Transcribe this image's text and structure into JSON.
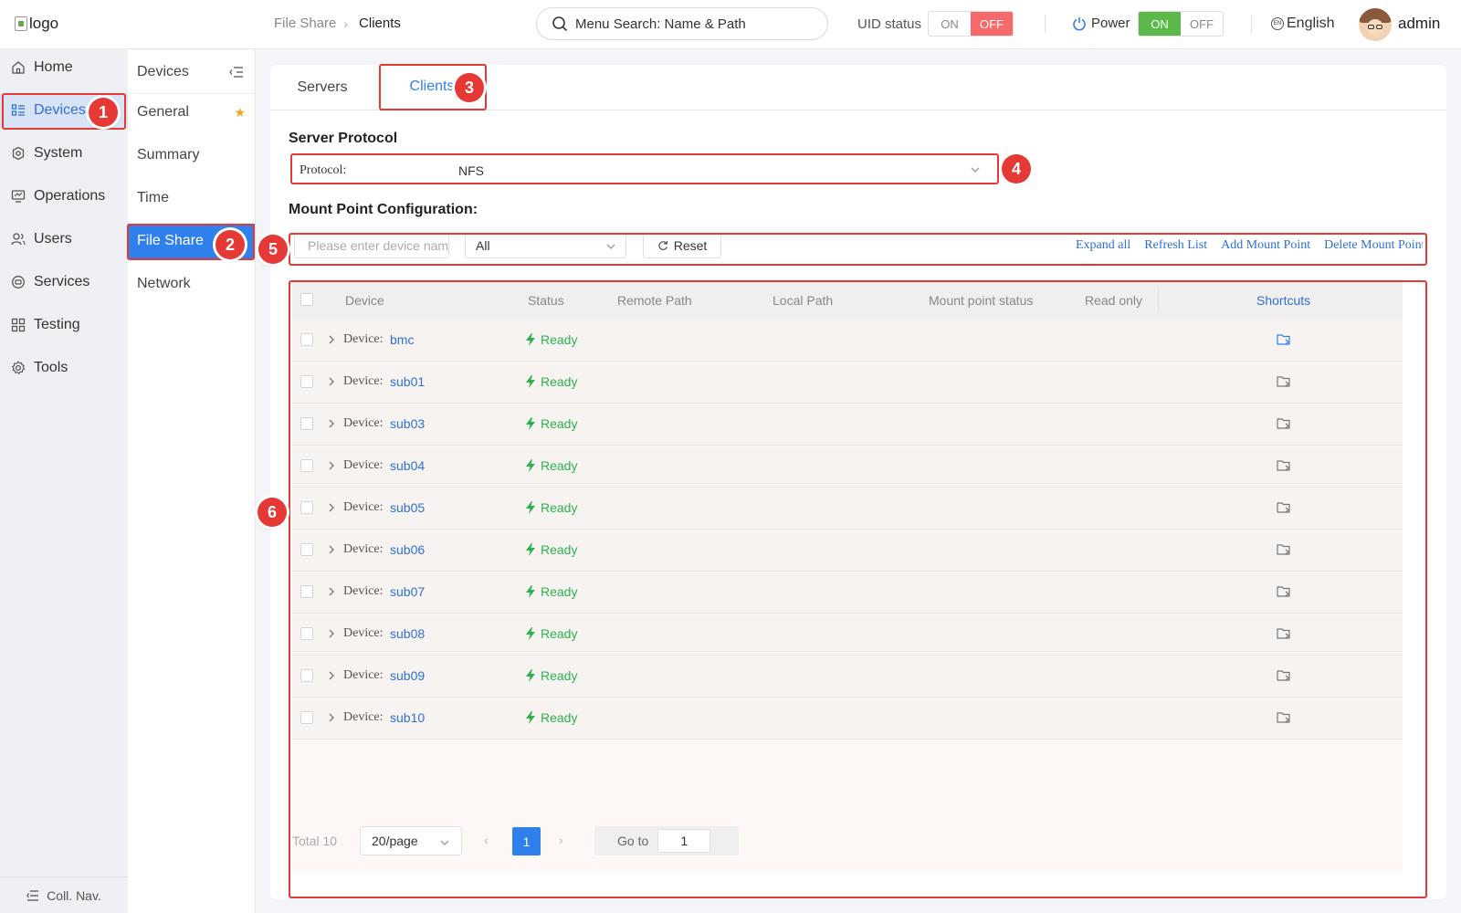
{
  "header": {
    "logo_alt": "logo",
    "breadcrumb": [
      "File Share",
      "Clients"
    ],
    "search_placeholder": "Menu Search: Name & Path",
    "uid_label": "UID status",
    "uid_on": "ON",
    "uid_off": "OFF",
    "uid_selected": "OFF",
    "power_label": "Power",
    "power_on": "ON",
    "power_off": "OFF",
    "power_selected": "ON",
    "language": "English",
    "username": "admin"
  },
  "nav": {
    "items": [
      {
        "label": "Home",
        "icon": "home-icon"
      },
      {
        "label": "Devices",
        "icon": "devices-icon",
        "active": true
      },
      {
        "label": "System",
        "icon": "system-icon"
      },
      {
        "label": "Operations",
        "icon": "operations-icon"
      },
      {
        "label": "Users",
        "icon": "users-icon"
      },
      {
        "label": "Services",
        "icon": "services-icon"
      },
      {
        "label": "Testing",
        "icon": "testing-icon"
      },
      {
        "label": "Tools",
        "icon": "tools-icon"
      }
    ],
    "collapse_label": "Coll. Nav."
  },
  "subnav": {
    "title": "Devices",
    "items": [
      {
        "label": "General",
        "favorite": true
      },
      {
        "label": "Summary"
      },
      {
        "label": "Time"
      },
      {
        "label": "File Share",
        "active": true
      },
      {
        "label": "Network"
      }
    ]
  },
  "tabs": [
    {
      "label": "Servers"
    },
    {
      "label": "Clients",
      "active": true
    }
  ],
  "server_protocol": {
    "title": "Server Protocol",
    "label": "Protocol:",
    "value": "NFS"
  },
  "mount": {
    "title": "Mount Point Configuration:",
    "search_placeholder": "Please enter device name",
    "filter_value": "All",
    "reset_label": "Reset",
    "actions": [
      "Expand all",
      "Refresh List",
      "Add Mount Point",
      "Delete Mount Point"
    ]
  },
  "table": {
    "columns": [
      "Device",
      "Status",
      "Remote Path",
      "Local Path",
      "Mount point status",
      "Read only",
      "Shortcuts"
    ],
    "device_prefix": "Device:",
    "rows": [
      {
        "device": "bmc",
        "status": "Ready"
      },
      {
        "device": "sub01",
        "status": "Ready"
      },
      {
        "device": "sub03",
        "status": "Ready"
      },
      {
        "device": "sub04",
        "status": "Ready"
      },
      {
        "device": "sub05",
        "status": "Ready"
      },
      {
        "device": "sub06",
        "status": "Ready"
      },
      {
        "device": "sub07",
        "status": "Ready"
      },
      {
        "device": "sub08",
        "status": "Ready"
      },
      {
        "device": "sub09",
        "status": "Ready"
      },
      {
        "device": "sub10",
        "status": "Ready"
      }
    ]
  },
  "pagination": {
    "total": "Total 10",
    "page_size": "20/page",
    "current_page": "1",
    "goto_label": "Go to",
    "goto_value": "1"
  },
  "annotations": [
    "1",
    "2",
    "3",
    "4",
    "5",
    "6"
  ],
  "colors": {
    "accent": "#2f80ed",
    "annotation": "#e53935",
    "ready": "#2bb24c",
    "off_toggle": "#f56b6b",
    "on_toggle": "#5bb94a"
  }
}
